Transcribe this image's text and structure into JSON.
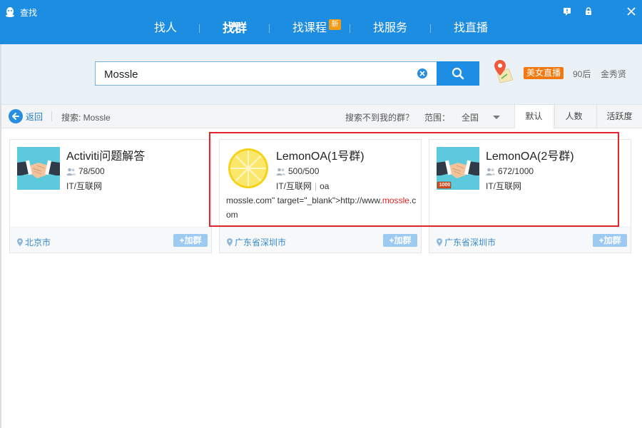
{
  "window": {
    "title": "查找"
  },
  "nav": {
    "items": [
      "找人",
      "找群",
      "找课程",
      "找服务",
      "找直播"
    ],
    "active_index": 1,
    "new_badge": "新"
  },
  "search": {
    "query": "Mossle"
  },
  "promo": {
    "live_tag": "美女直播",
    "links": [
      "90后",
      "金秀贤"
    ]
  },
  "toolbar": {
    "back_label": "返回",
    "search_label": "搜索: Mossle",
    "not_found": "搜索不到我的群？",
    "range_label": "范围：",
    "range_value": "全国",
    "sort_tabs": [
      "默认",
      "人数",
      "活跃度"
    ],
    "active_sort": 0
  },
  "cards": [
    {
      "name": "Activiti问题解答",
      "members": "78/500",
      "tag1": "IT/互联网",
      "tag2": "",
      "location": "北京市",
      "join": "+加群"
    },
    {
      "name": "LemonOA(1号群)",
      "members": "500/500",
      "tag1": "IT/互联网",
      "tag2": "oa",
      "desc_a": "mossle.com\" target=\"_blank\">http://www.",
      "desc_hl1": "mos",
      "desc_hl2": "sle",
      "desc_b": ".com",
      "location": "广东省深圳市",
      "join": "+加群"
    },
    {
      "name": "LemonOA(2号群)",
      "members": "672/1000",
      "tag1": "IT/互联网",
      "tag2": "",
      "location": "广东省深圳市",
      "join": "+加群",
      "avatar_badge": "1000"
    }
  ],
  "colors": {
    "header_blue": "#1c8de1",
    "accent_orange": "#f3780f",
    "link_blue": "#3a8ccb",
    "highlight_red": "#e0252b"
  }
}
